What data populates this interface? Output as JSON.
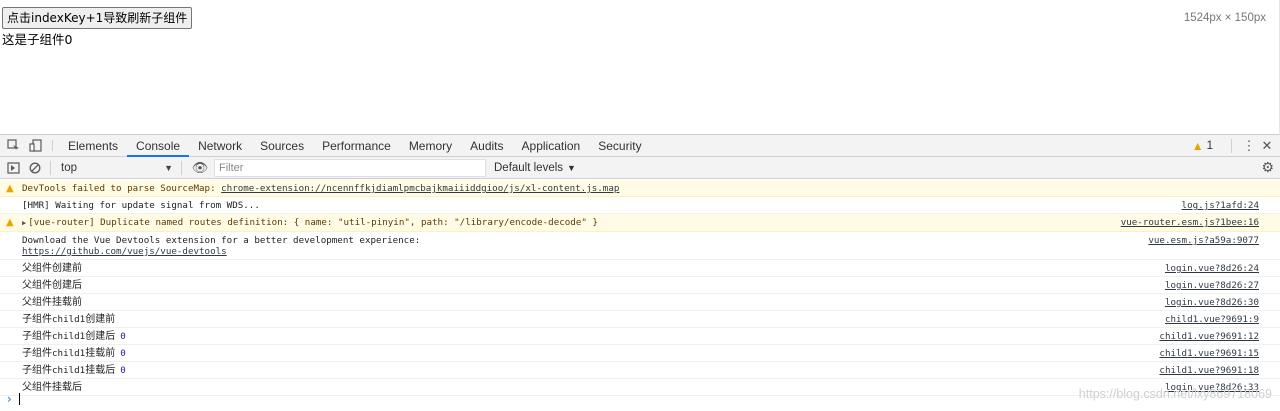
{
  "page": {
    "button_label": "点击indexKey+1导致刷新子组件",
    "child_text": "这是子组件0",
    "dimensions": "1524px × 150px"
  },
  "devtools": {
    "tabs": [
      "Elements",
      "Console",
      "Network",
      "Sources",
      "Performance",
      "Memory",
      "Audits",
      "Application",
      "Security"
    ],
    "active_tab": "Console",
    "warning_count": "1",
    "context": "top",
    "filter_placeholder": "Filter",
    "levels": "Default levels"
  },
  "messages": [
    {
      "type": "warn",
      "text": "DevTools failed to parse SourceMap: ",
      "link": "chrome-extension://ncennffkjdiamlpmcbajkmaiiiddgioo/js/xl-content.js.map",
      "source": ""
    },
    {
      "type": "log",
      "text": "[HMR] Waiting for update signal from WDS...",
      "source": "log.js?1afd:24"
    },
    {
      "type": "warn",
      "text": "[vue-router] Duplicate named routes definition: { name: \"util-pinyin\", path: \"/library/encode-decode\" }",
      "source": "vue-router.esm.js?1bee:16"
    },
    {
      "type": "log",
      "text": "Download the Vue Devtools extension for a better development experience:",
      "link": "https://github.com/vuejs/vue-devtools",
      "source": "vue.esm.js?a59a:9077"
    },
    {
      "type": "log",
      "cn": "父组件创建前",
      "source": "login.vue?8d26:24"
    },
    {
      "type": "log",
      "cn": "父组件创建后",
      "source": "login.vue?8d26:27"
    },
    {
      "type": "log",
      "cn": "父组件挂载前",
      "source": "login.vue?8d26:30"
    },
    {
      "type": "log",
      "cn1": "子组件",
      "mono": "child1",
      "cn2": "创建前",
      "source": "child1.vue?9691:9"
    },
    {
      "type": "log",
      "cn1": "子组件",
      "mono": "child1",
      "cn2": "创建后",
      "num": "0",
      "source": "child1.vue?9691:12"
    },
    {
      "type": "log",
      "cn1": "子组件",
      "mono": "child1",
      "cn2": "挂载前",
      "num": "0",
      "source": "child1.vue?9691:15"
    },
    {
      "type": "log",
      "cn1": "子组件",
      "mono": "child1",
      "cn2": "挂载后",
      "num": "0",
      "source": "child1.vue?9691:18"
    },
    {
      "type": "log",
      "cn": "父组件挂载后",
      "source": "login.vue?8d26:33"
    }
  ],
  "watermark": "https://blog.csdn.net/lxy869718069",
  "icons": [
    "inspect-icon",
    "device-icon",
    "warning-icon",
    "kebab-icon",
    "close-icon",
    "sidebar-icon",
    "clear-icon",
    "eye-icon",
    "gear-icon",
    "prompt-chevron-icon"
  ],
  "colors": {
    "active_tab": "#1a73e8",
    "warning_bg": "#fffbe5",
    "warning_icon": "#e8a600"
  }
}
